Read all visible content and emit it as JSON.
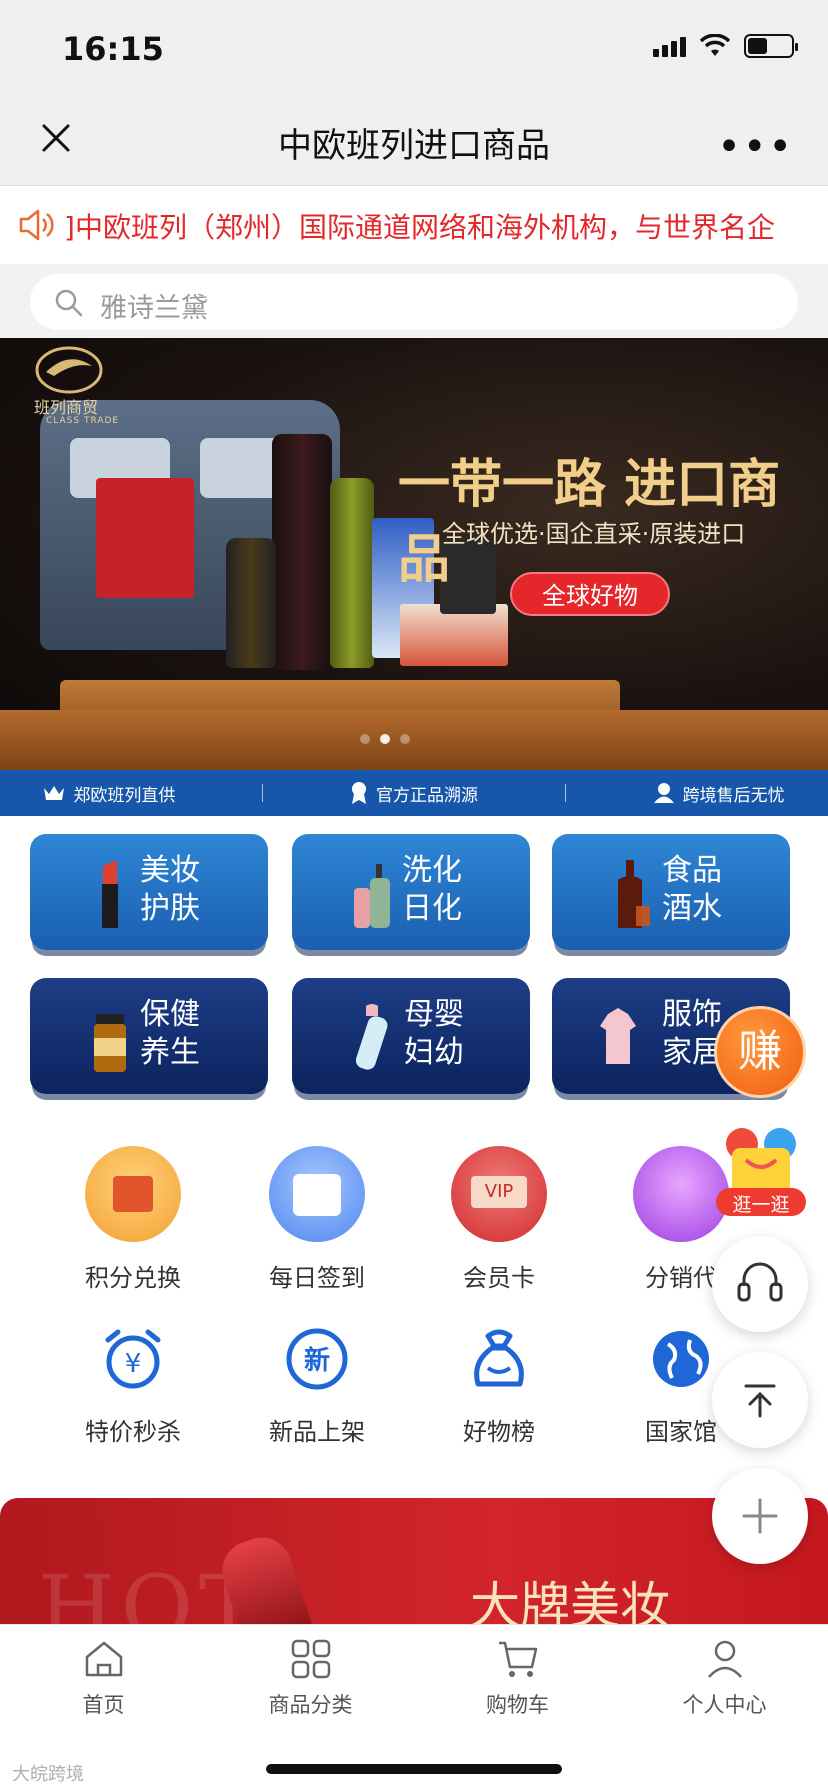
{
  "status": {
    "time": "16:15"
  },
  "nav": {
    "title": "中欧班列进口商品"
  },
  "notice": {
    "text": "中欧班列（郑州）国际通道网络和海外机构，与世界名企",
    "prefix": "]"
  },
  "search": {
    "placeholder": "雅诗兰黛"
  },
  "banner": {
    "brand_cn": "班列商贸",
    "brand_en": "CLASS TRADE",
    "title": "一带一路 进口商品",
    "subtitle": "全球优选·国企直采·原装进口",
    "button": "全球好物",
    "slide_count": 3,
    "active_slide": 2
  },
  "guarantees": [
    {
      "label": "郑欧班列直供",
      "icon": "crown-icon"
    },
    {
      "label": "官方正品溯源",
      "icon": "ribbon-icon"
    },
    {
      "label": "跨境售后无忧",
      "icon": "user-icon"
    }
  ],
  "categories": [
    {
      "line1": "美妆",
      "line2": "护肤",
      "icon": "lipstick-icon"
    },
    {
      "line1": "洗化",
      "line2": "日化",
      "icon": "lotion-icon"
    },
    {
      "line1": "食品",
      "line2": "酒水",
      "icon": "liquor-icon"
    },
    {
      "line1": "保健",
      "line2": "养生",
      "icon": "supplement-icon"
    },
    {
      "line1": "母婴",
      "line2": "妇幼",
      "icon": "baby-bottle-icon"
    },
    {
      "line1": "服饰",
      "line2": "家居",
      "icon": "dress-icon"
    }
  ],
  "quick_menu": [
    {
      "label": "积分兑换",
      "icon": "points-icon"
    },
    {
      "label": "每日签到",
      "icon": "calendar-check-icon"
    },
    {
      "label": "会员卡",
      "icon": "vip-card-icon"
    },
    {
      "label": "分销代",
      "icon": "gift-box-icon"
    },
    {
      "label": "特价秒杀",
      "icon": "alarm-yen-icon"
    },
    {
      "label": "新品上架",
      "icon": "new-badge-icon"
    },
    {
      "label": "好物榜",
      "icon": "bag-icon"
    },
    {
      "label": "国家馆",
      "icon": "globe-icon"
    }
  ],
  "promo": {
    "bg_text": "HOT",
    "title": "大牌美妆"
  },
  "floating": {
    "earn": "赚",
    "browse": "逛一逛"
  },
  "tabs": [
    {
      "label": "首页",
      "icon": "home-icon"
    },
    {
      "label": "商品分类",
      "icon": "grid-icon"
    },
    {
      "label": "购物车",
      "icon": "cart-icon"
    },
    {
      "label": "个人中心",
      "icon": "person-icon"
    }
  ],
  "watermark": "大皖跨境",
  "colors": {
    "accent_red": "#e4272b",
    "brand_blue": "#1657ab",
    "earn_orange": "#ef5c12"
  }
}
